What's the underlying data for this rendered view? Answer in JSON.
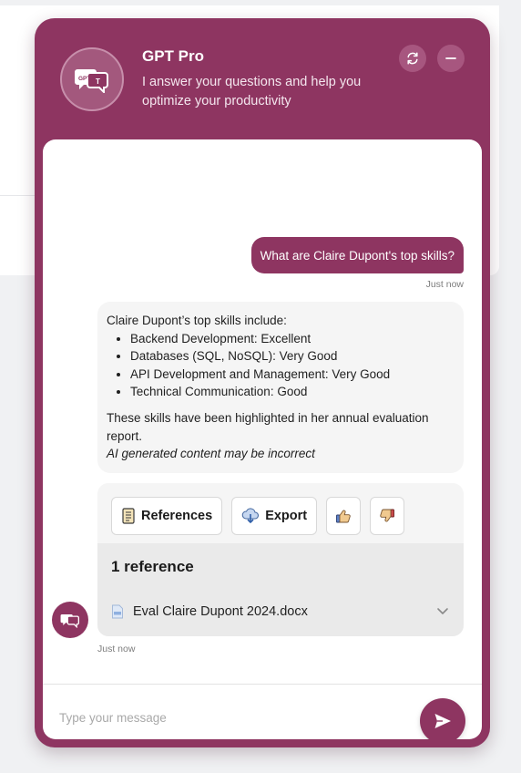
{
  "header": {
    "title": "GPT Pro",
    "subtitle": "I answer your questions and help you optimize your productivity",
    "logo_text_left": "GPT",
    "logo_text_right": "T",
    "refresh_icon": "refresh-icon",
    "minimize_icon": "minus-icon"
  },
  "conversation": {
    "user_message": "What are Claire Dupont's top skills?",
    "user_timestamp": "Just now",
    "bot_intro": "Claire Dupont’s top skills include:",
    "skills": [
      "Backend Development: Excellent",
      "Databases (SQL, NoSQL): Very Good",
      "API Development and Management: Very Good",
      "Technical Communication: Good"
    ],
    "bot_summary": "These skills have been highlighted in her annual evaluation report.",
    "disclaimer": "AI generated content may be incorrect",
    "bot_timestamp": "Just now"
  },
  "actions": {
    "references_label": "References",
    "export_label": "Export",
    "thumbs_up_icon": "thumbs-up-icon",
    "thumbs_down_icon": "thumbs-down-icon"
  },
  "references": {
    "title": "1 reference",
    "items": [
      {
        "name": "Eval Claire Dupont 2024.docx",
        "icon": "docx-file-icon"
      }
    ]
  },
  "composer": {
    "placeholder": "Type your message",
    "send_icon": "send-icon"
  },
  "colors": {
    "brand": "#8e3561",
    "bubble_bg": "#f5f5f5"
  }
}
